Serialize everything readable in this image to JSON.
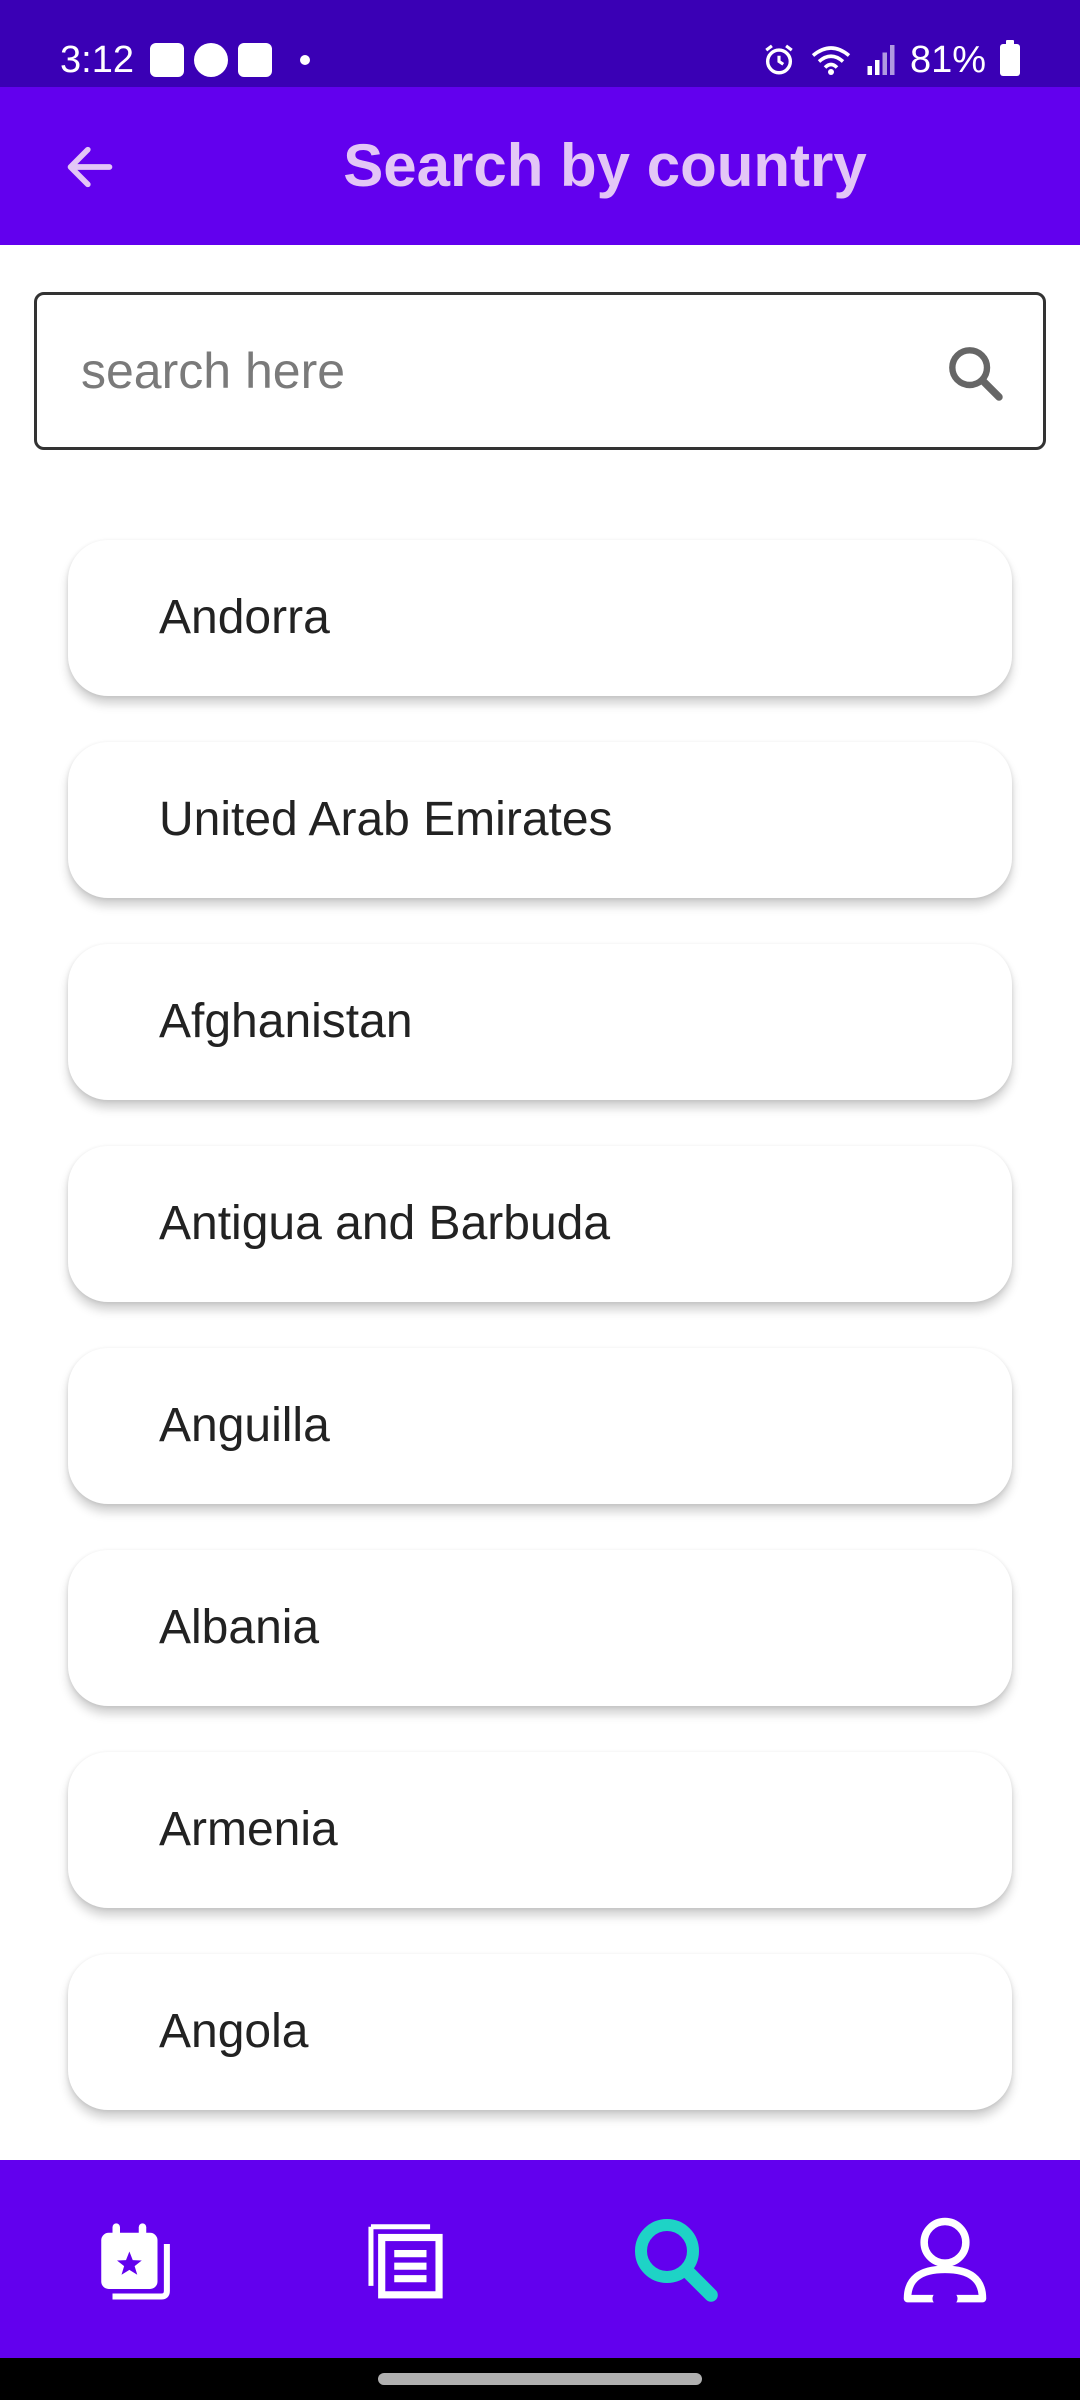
{
  "status_bar": {
    "time": "3:12",
    "battery": "81%",
    "left_icons": [
      "gallery-icon",
      "facebook-icon",
      "outlook-icon",
      "notification-dot"
    ],
    "right_icons": [
      "alarm-icon",
      "wifi-icon",
      "signal-icon",
      "battery-icon"
    ]
  },
  "app_bar": {
    "title": "Search by country",
    "back_icon": "arrow-back-icon"
  },
  "search": {
    "placeholder": "search here",
    "value": "",
    "icon": "search-icon"
  },
  "countries": [
    "Andorra",
    "United Arab Emirates",
    "Afghanistan",
    "Antigua and Barbuda",
    "Anguilla",
    "Albania",
    "Armenia",
    "Angola"
  ],
  "bottom_nav": {
    "items": [
      {
        "icon": "calendar-star-icon",
        "active": false
      },
      {
        "icon": "list-pages-icon",
        "active": false
      },
      {
        "icon": "search-icon",
        "active": true
      },
      {
        "icon": "person-icon",
        "active": false
      }
    ]
  },
  "colors": {
    "status_bar": "#3a00b5",
    "primary": "#6200ee",
    "title_text": "#e3c6f6",
    "active_nav": "#1ed3c6",
    "card_text": "#222222"
  }
}
